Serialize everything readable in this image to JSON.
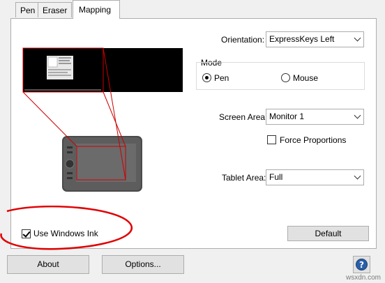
{
  "tabs": [
    {
      "label": "Pen"
    },
    {
      "label": "Eraser"
    },
    {
      "label": "Mapping"
    }
  ],
  "orientation": {
    "label": "Orientation:",
    "value": "ExpressKeys Left"
  },
  "mode": {
    "title": "Mode",
    "pen_label": "Pen",
    "mouse_label": "Mouse",
    "selected": "Pen"
  },
  "screen_area": {
    "label": "Screen Area:",
    "value": "Monitor 1"
  },
  "force_proportions": {
    "label": "Force Proportions",
    "checked": false
  },
  "tablet_area": {
    "label": "Tablet Area:",
    "value": "Full"
  },
  "use_windows_ink": {
    "label": "Use Windows Ink",
    "checked": true
  },
  "buttons": {
    "default": "Default",
    "about": "About",
    "options": "Options..."
  },
  "help_icon": "question-mark-icon",
  "watermark": "wsxdn.com",
  "colors": {
    "mapping_lines": "#cc0000",
    "annotation_ellipse": "#e00000",
    "help_blue": "#2a5fa8"
  }
}
